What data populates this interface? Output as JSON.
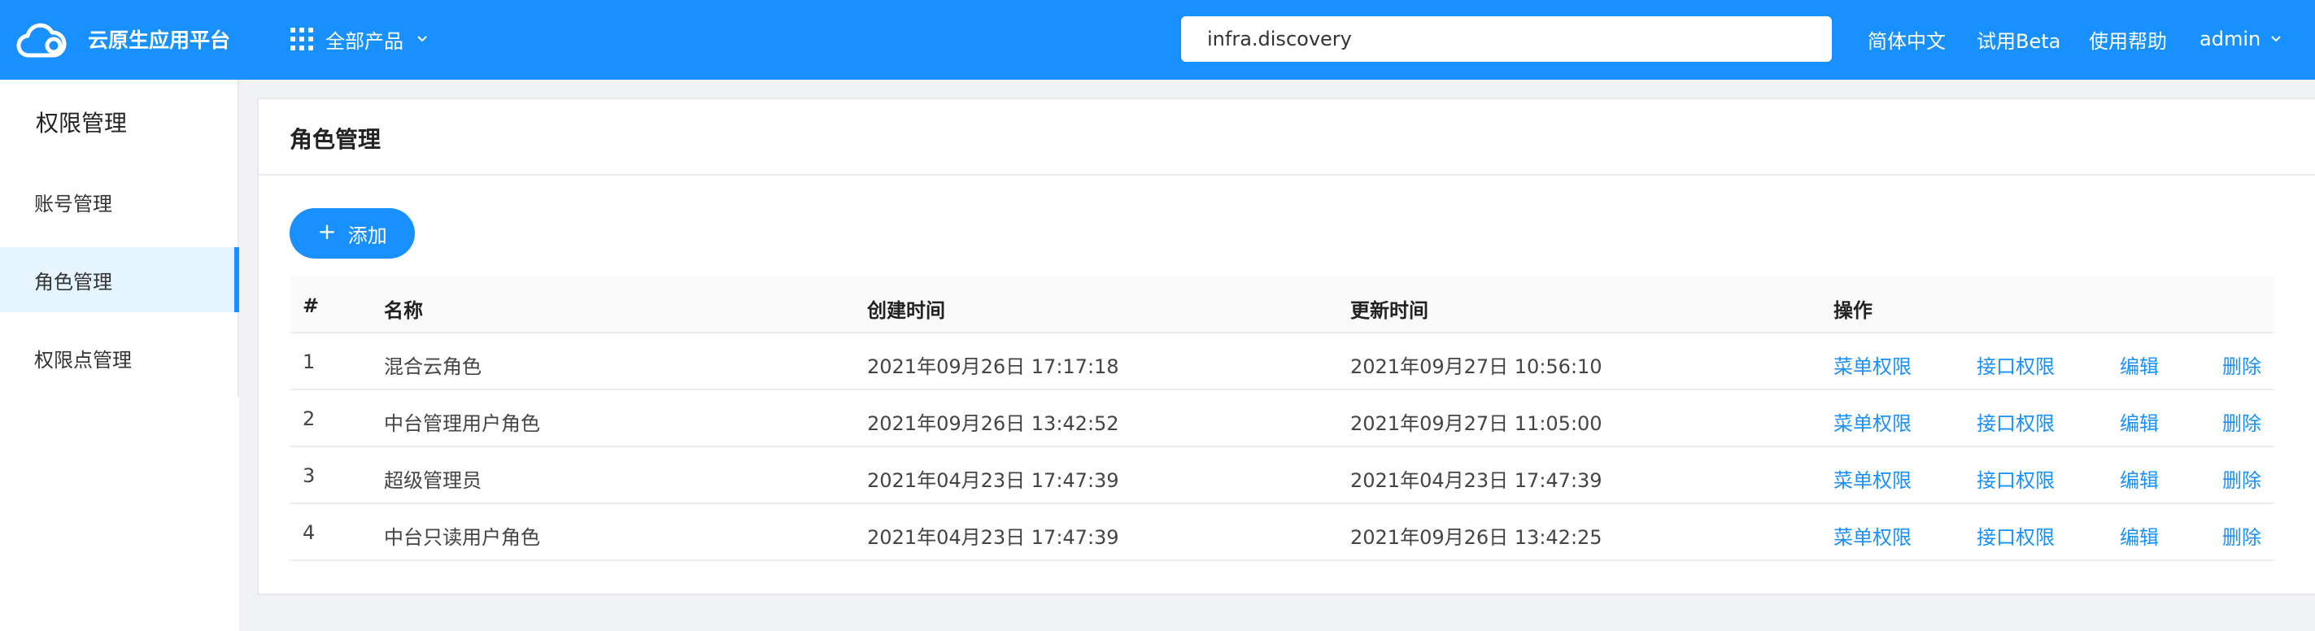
{
  "header": {
    "brand": "云原生应用平台",
    "products_label": "全部产品",
    "search_value": "infra.discovery",
    "lang": "简体中文",
    "beta": "试用Beta",
    "help": "使用帮助",
    "user": "admin",
    "accent": "#1890ff"
  },
  "sidebar": {
    "title": "权限管理",
    "items": [
      {
        "label": "账号管理",
        "active": false
      },
      {
        "label": "角色管理",
        "active": true
      },
      {
        "label": "权限点管理",
        "active": false
      }
    ]
  },
  "main": {
    "title": "角色管理",
    "add_label": "添加",
    "columns": [
      "#",
      "名称",
      "创建时间",
      "更新时间",
      "操作"
    ],
    "rows": [
      {
        "index": "1",
        "name": "混合云角色",
        "created": "2021年09月26日 17:17:18",
        "updated": "2021年09月27日 10:56:10"
      },
      {
        "index": "2",
        "name": "中台管理用户角色",
        "created": "2021年09月26日 13:42:52",
        "updated": "2021年09月27日 11:05:00"
      },
      {
        "index": "3",
        "name": "超级管理员",
        "created": "2021年04月23日 17:47:39",
        "updated": "2021年04月23日 17:47:39"
      },
      {
        "index": "4",
        "name": "中台只读用户角色",
        "created": "2021年04月23日 17:47:39",
        "updated": "2021年09月26日 13:42:25"
      }
    ],
    "actions": {
      "menu_perm": "菜单权限",
      "api_perm": "接口权限",
      "edit": "编辑",
      "delete": "删除"
    }
  }
}
